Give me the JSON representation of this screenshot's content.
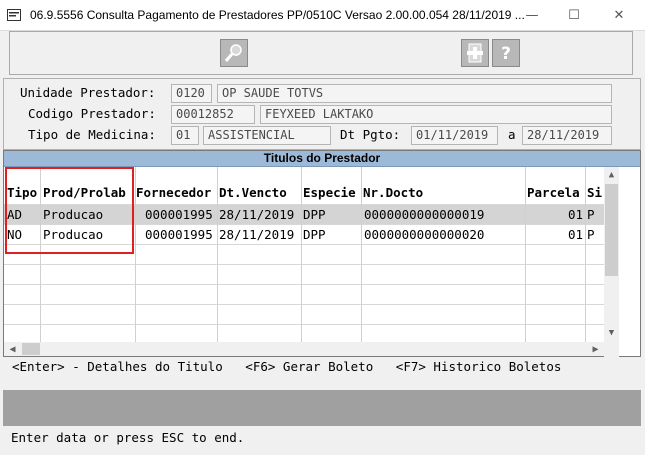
{
  "window": {
    "title": "06.9.5556  Consulta  Pagamento de Prestadores PP/0510C Versao 2.00.00.054 28/11/2019 ...",
    "controls": {
      "minimize": "—",
      "maximize": "☐",
      "close": "✕"
    }
  },
  "toolbar": {
    "icons": [
      "search-icon",
      "zoom-icon",
      "help-icon"
    ]
  },
  "form": {
    "unidade_label": "Unidade Prestador:",
    "unidade_code": "0120",
    "unidade_name": "OP SAUDE TOTVS",
    "codigo_label": "Codigo Prestador:",
    "codigo_code": "00012852",
    "codigo_name": "FEYXEED LAKTAKO",
    "tipo_label": "Tipo de Medicina:",
    "tipo_code": "01",
    "tipo_name": "ASSISTENCIAL",
    "dtpgto_label": "Dt Pgto:",
    "dtpgto_from": "01/11/2019",
    "dtpgto_sep": "a",
    "dtpgto_to": "28/11/2019"
  },
  "grid": {
    "caption": "Titulos do Prestador",
    "columns": [
      "Tipo",
      "Prod/Prolab",
      "Fornecedor",
      "Dt.Vencto",
      "Especie",
      "Nr.Docto",
      "Parcela",
      "Si"
    ],
    "rows": [
      [
        "AD",
        "Producao",
        "000001995",
        "28/11/2019",
        "DPP",
        "0000000000000019",
        "01",
        "P"
      ],
      [
        "NO",
        "Producao",
        "000001995",
        "28/11/2019",
        "DPP",
        "0000000000000020",
        "01",
        "P"
      ]
    ],
    "highlight_color": "#e02020",
    "caption_color": "#9db9d8"
  },
  "hint": "<Enter> - Detalhes do Titulo   <F6> Gerar Boleto   <F7> Historico Boletos",
  "status_message": "Enter data or press ESC to end."
}
